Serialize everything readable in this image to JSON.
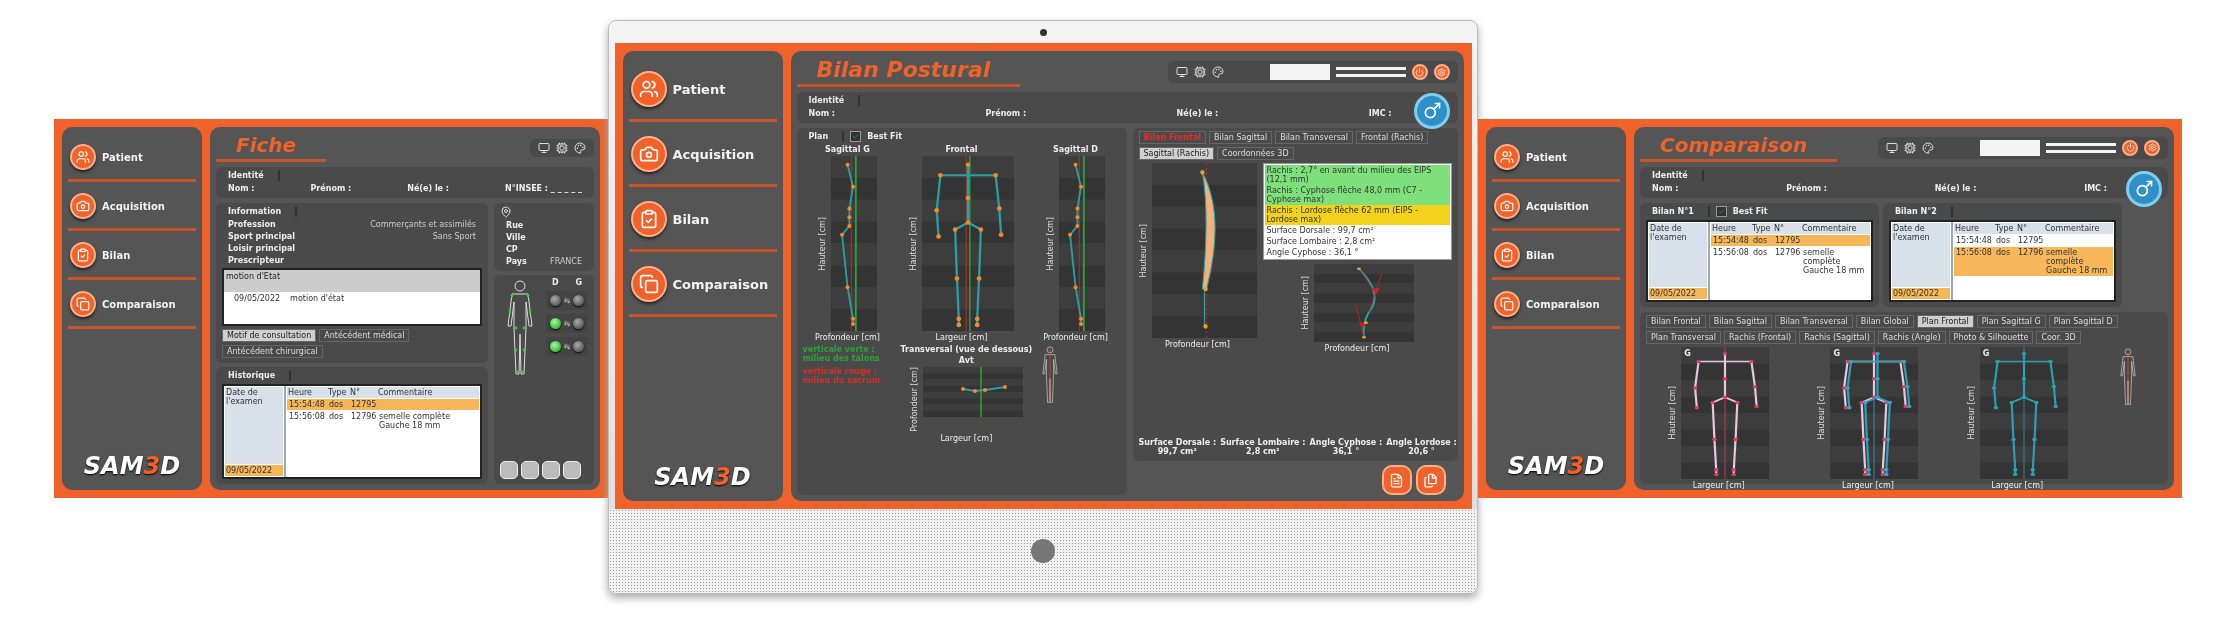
{
  "left_screen": {
    "nav": [
      {
        "label": "Patient",
        "kind": "patient"
      },
      {
        "label": "Acquisition",
        "kind": "camera"
      },
      {
        "label": "Bilan",
        "kind": "report"
      },
      {
        "label": "Comparaison",
        "kind": "compare"
      }
    ],
    "logo": {
      "main": "SAM",
      "accent": "3",
      "tail": "D"
    },
    "title": "Fiche",
    "identity": {
      "tab": "Identité",
      "fields": [
        "Nom :",
        "Prénom :",
        "Né(e) le :",
        "N°INSEE : _ _ _ _ _"
      ]
    },
    "information": {
      "tab": "Information",
      "rows": [
        {
          "label": "Profession",
          "value": "Commerçants et assimilés"
        },
        {
          "label": "Sport principal",
          "value": "Sans Sport"
        },
        {
          "label": "Loisir principal"
        },
        {
          "label": "Prescripteur"
        }
      ]
    },
    "motif": {
      "header": "motion d'Etat",
      "date": "09/05/2022",
      "text": "motion d'état"
    },
    "motif_tabs": [
      {
        "label": "Motif de consultation",
        "selected": true
      },
      {
        "label": "Antécédent médical",
        "selected": false
      },
      {
        "label": "Antécédent chirurgical",
        "selected": false
      }
    ],
    "address": [
      "Rue",
      "Ville",
      "CP",
      "Pays"
    ],
    "country": "FRANCE",
    "sides": [
      "D",
      "G"
    ],
    "lights": [
      {
        "left_on": false,
        "right_on": false
      },
      {
        "left_on": true,
        "right_on": false
      },
      {
        "left_on": true,
        "right_on": false
      }
    ],
    "history": {
      "tab": "Historique",
      "date_header": "Date de l'examen",
      "dates": [
        {
          "label": "09/05/2022",
          "selected": true
        }
      ],
      "columns": [
        "Heure",
        "Type",
        "N°",
        "Commentaire"
      ],
      "rows": [
        {
          "cells": [
            "15:54:48",
            "dos",
            "12795",
            ""
          ],
          "selected": true
        },
        {
          "cells": [
            "15:56:08",
            "dos",
            "12796",
            "semelle complète Gauche 18 mm"
          ],
          "selected": false
        }
      ]
    }
  },
  "center_screen": {
    "nav": [
      {
        "label": "Patient",
        "kind": "patient"
      },
      {
        "label": "Acquisition",
        "kind": "camera"
      },
      {
        "label": "Bilan",
        "kind": "report"
      },
      {
        "label": "Comparaison",
        "kind": "compare"
      }
    ],
    "logo": {
      "main": "SAM",
      "accent": "3",
      "tail": "D"
    },
    "title": "Bilan Postural",
    "identity": {
      "tab": "Identité",
      "fields": [
        "Nom :",
        "Prénom :",
        "Né(e) le :",
        "IMC :"
      ]
    },
    "plan_tab": "Plan",
    "best_fit": {
      "label": "Best Fit",
      "checked": true
    },
    "plots": [
      {
        "kind": "sagittal",
        "title": "Sagittal G",
        "xlabel": "Profondeur [cm]",
        "ylabel": "Hauteur [cm]"
      },
      {
        "kind": "frontal",
        "title": "Frontal",
        "xlabel": "Largeur [cm]",
        "ylabel": "Hauteur [cm]"
      },
      {
        "kind": "sagittal",
        "title": "Sagittal D",
        "xlabel": "Profondeur [cm]",
        "ylabel": "Hauteur [cm]"
      }
    ],
    "legend": [
      {
        "text": "verticale verte : milieu des talons",
        "color": "#2fa03a"
      },
      {
        "text": "verticale rouge : milieu du sacrum",
        "color": "#d0302a"
      }
    ],
    "transversal": {
      "title": "Transversal (vue de dessous)",
      "label": "Avt",
      "xlabel": "Largeur [cm]",
      "ylabel": "Profondeur [cm]"
    },
    "side_tabs": [
      {
        "label": "Bilan Frontal",
        "selected": false,
        "color": "#e0302a"
      },
      {
        "label": "Bilan Sagittal",
        "selected": false
      },
      {
        "label": "Bilan Transversal",
        "selected": false
      },
      {
        "label": "Frontal (Rachis)",
        "selected": false
      },
      {
        "label": "Sagittal (Rachis)",
        "selected": true
      },
      {
        "label": "Coordonnées 3D",
        "selected": false
      }
    ],
    "messages": [
      {
        "text": "Rachis : 2,7° en avant du milieu des EIPS (12,1 mm)",
        "color": "#7ee07a"
      },
      {
        "text": "Rachis : Cyphose flèche 48,0 mm (C7 - Cyphose max)",
        "color": "#7ee07a"
      },
      {
        "text": "Rachis : Lordose flèche 62 mm (EIPS - Lordose max)",
        "color": "#f2d21a"
      },
      {
        "text": "Surface Dorsale : 99,7 cm²"
      },
      {
        "text": "Surface Lombaire : 2,8 cm²"
      },
      {
        "text": "Angle Cyphose : 36,1 °"
      }
    ],
    "spine_plots": [
      {
        "xlabel": "Profondeur [cm]",
        "ylabel": "Hauteur [cm]"
      },
      {
        "xlabel": "Profondeur [cm]",
        "ylabel": "Hauteur [cm]"
      }
    ],
    "results": [
      {
        "label": "Surface Dorsale :",
        "value": "99,7 cm²"
      },
      {
        "label": "Surface Lombaire :",
        "value": "2,8 cm²"
      },
      {
        "label": "Angle Cyphose :",
        "value": "36,1 °"
      },
      {
        "label": "Angle Lordose :",
        "value": "20,6 °"
      }
    ]
  },
  "right_screen": {
    "nav": [
      {
        "label": "Patient",
        "kind": "patient"
      },
      {
        "label": "Acquisition",
        "kind": "camera"
      },
      {
        "label": "Bilan",
        "kind": "report"
      },
      {
        "label": "Comparaison",
        "kind": "compare"
      }
    ],
    "logo": {
      "main": "SAM",
      "accent": "3",
      "tail": "D"
    },
    "title": "Comparaison",
    "identity": {
      "tab": "Identité",
      "fields": [
        "Nom :",
        "Prénom :",
        "Né(e) le :",
        "IMC :"
      ]
    },
    "bilans": [
      {
        "tab": "Bilan N°1",
        "best_fit": {
          "label": "Best Fit",
          "checked": true
        },
        "date_header": "Date de l'examen",
        "dates": [
          {
            "label": "09/05/2022",
            "selected": true
          }
        ],
        "columns": [
          "Heure",
          "Type",
          "N°",
          "Commentaire"
        ],
        "rows": [
          {
            "cells": [
              "15:54:48",
              "dos",
              "12795",
              ""
            ],
            "selected": true
          },
          {
            "cells": [
              "15:56:08",
              "dos",
              "12796",
              "semelle complète Gauche 18 mm"
            ],
            "selected": false
          }
        ]
      },
      {
        "tab": "Bilan N°2",
        "date_header": "Date de l'examen",
        "dates": [
          {
            "label": "09/05/2022",
            "selected": true
          }
        ],
        "columns": [
          "Heure",
          "Type",
          "N°",
          "Commentaire"
        ],
        "rows": [
          {
            "cells": [
              "15:54:48",
              "dos",
              "12795",
              ""
            ],
            "selected": false
          },
          {
            "cells": [
              "15:56:08",
              "dos",
              "12796",
              "semelle complète Gauche 18 mm"
            ],
            "selected": true
          }
        ]
      }
    ],
    "tabs": [
      {
        "label": "Bilan Frontal",
        "selected": false
      },
      {
        "label": "Bilan Sagittal",
        "selected": false
      },
      {
        "label": "Bilan Transversal",
        "selected": false
      },
      {
        "label": "Bilan Global",
        "selected": false
      },
      {
        "label": "Plan Frontal",
        "selected": true
      },
      {
        "label": "Plan Sagittal G",
        "selected": false
      },
      {
        "label": "Plan Sagittal D",
        "selected": false
      },
      {
        "label": "Plan Transversal",
        "selected": false
      },
      {
        "label": "Rachis (Frontal)",
        "selected": false
      },
      {
        "label": "Rachis (Sagittal)",
        "selected": false
      },
      {
        "label": "Rachis (Angle)",
        "selected": false
      },
      {
        "label": "Photo & Silhouette",
        "selected": false
      },
      {
        "label": "Coor. 3D",
        "selected": false
      }
    ],
    "plots": [
      {
        "kind": "bilan1",
        "corner": "G",
        "xlabel": "Largeur [cm]",
        "ylabel": "Hauteur [cm]"
      },
      {
        "kind": "overlay",
        "corner": "G",
        "xlabel": "Largeur [cm]",
        "ylabel": "Hauteur [cm]"
      },
      {
        "kind": "bilan2",
        "corner": "G",
        "xlabel": "Largeur [cm]",
        "ylabel": "Hauteur [cm]"
      }
    ]
  }
}
